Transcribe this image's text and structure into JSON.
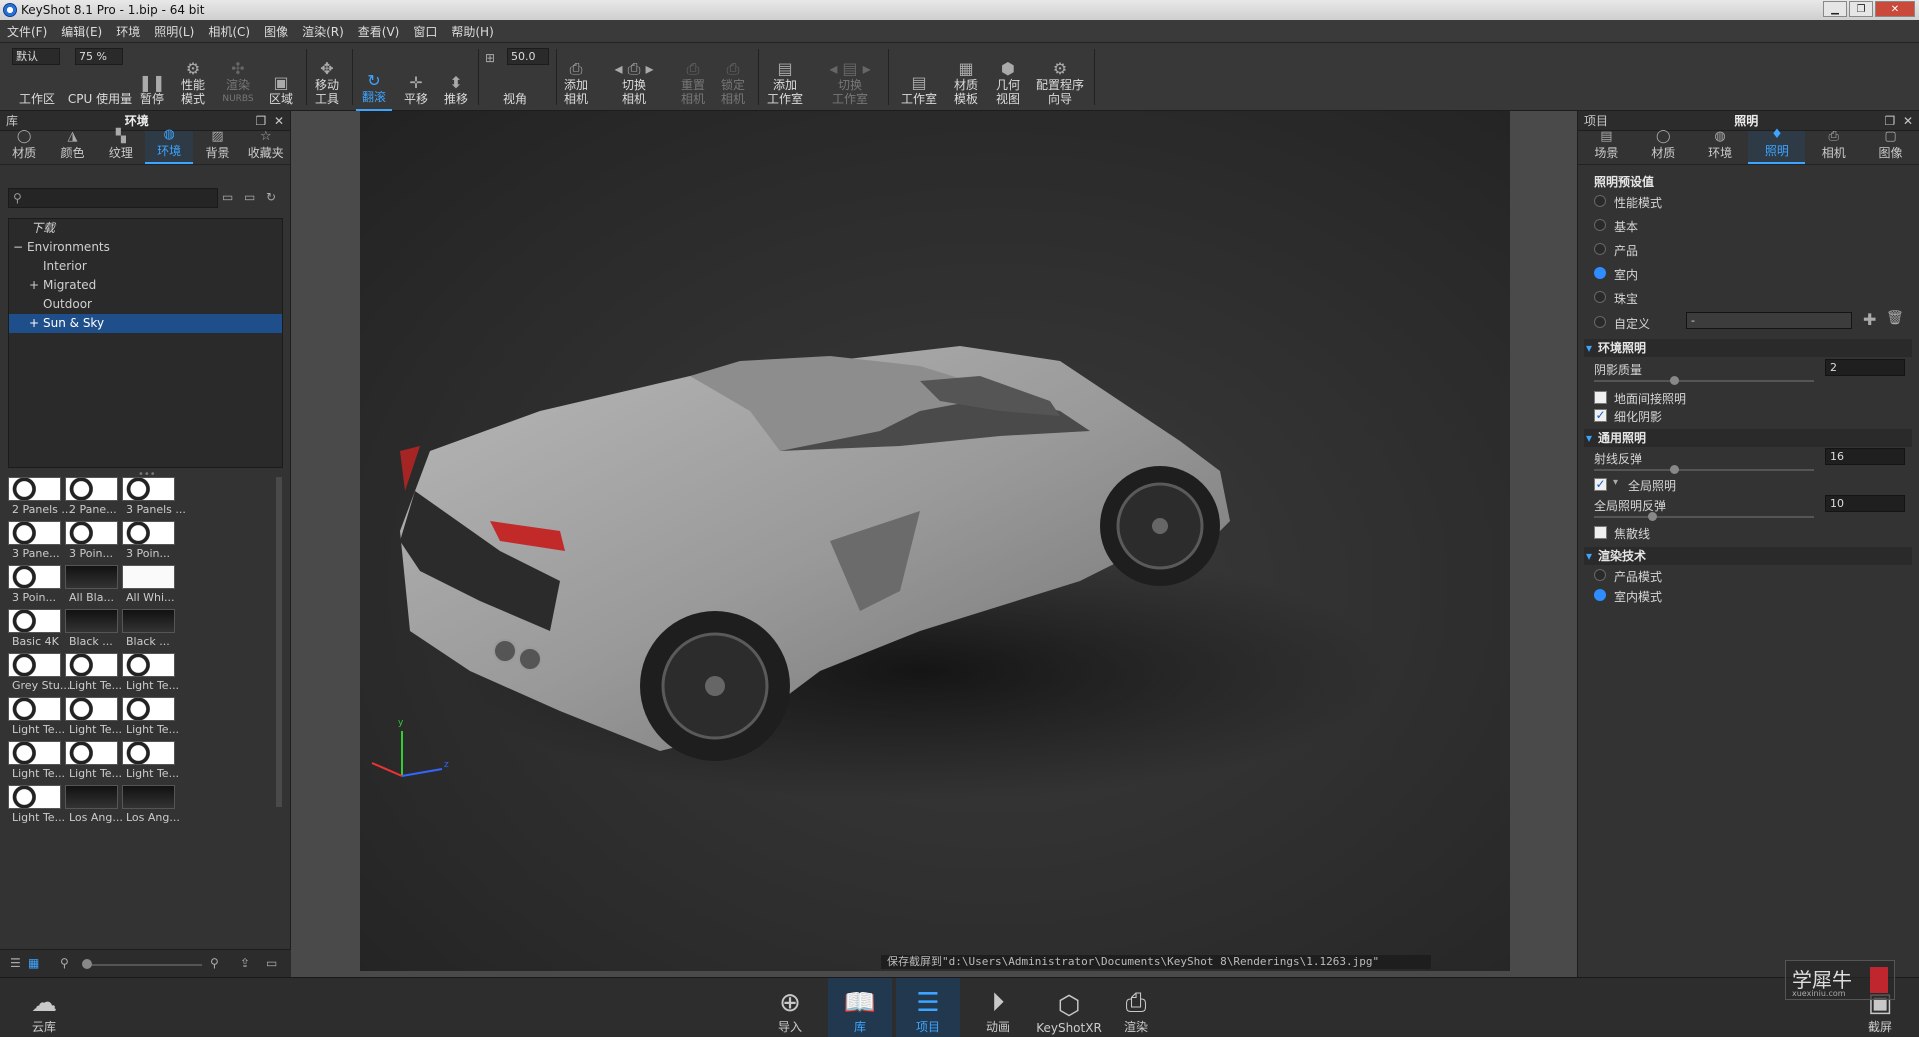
{
  "window": {
    "title": "KeyShot 8.1 Pro  - 1.bip  - 64 bit"
  },
  "menu": [
    "文件(F)",
    "编辑(E)",
    "环境",
    "照明(L)",
    "相机(C)",
    "图像",
    "渲染(R)",
    "查看(V)",
    "窗口",
    "帮助(H)"
  ],
  "toolbar": {
    "workspace_value": "默认",
    "workspace_label": "工作区",
    "cpu_value": "75 %",
    "cpu_label": "CPU 使用量",
    "pause": "暂停",
    "perf_mode_1": "性能",
    "perf_mode_2": "模式",
    "nurbs_1": "渲染",
    "nurbs_2": "NURBS",
    "region": "区域",
    "move_1": "移动",
    "move_2": "工具",
    "tumble": "翻滚",
    "pan": "平移",
    "dolly": "推移",
    "fov_value": "50.0",
    "fov_label": "视角",
    "add_cam_1": "添加",
    "add_cam_2": "相机",
    "switch_cam_1": "切换",
    "switch_cam_2": "相机",
    "reset_cam_1": "重置",
    "reset_cam_2": "相机",
    "lock_cam_1": "锁定",
    "lock_cam_2": "相机",
    "add_studio_1": "添加",
    "add_studio_2": "工作室",
    "switch_studio_1": "切换",
    "switch_studio_2": "工作室",
    "studio": "工作室",
    "mat_tpl_1": "材质",
    "mat_tpl_2": "模板",
    "geo_view_1": "几何",
    "geo_view_2": "视图",
    "wizard_1": "配置程序",
    "wizard_2": "向导"
  },
  "library": {
    "header": "库",
    "title": "环境",
    "tabs": [
      "材质",
      "颜色",
      "纹理",
      "环境",
      "背景",
      "收藏夹"
    ],
    "tree": [
      {
        "label": "下载",
        "indent": 0,
        "expander": ""
      },
      {
        "label": "Environments",
        "indent": 0,
        "expander": "−"
      },
      {
        "label": "Interior",
        "indent": 1,
        "expander": ""
      },
      {
        "label": "Migrated",
        "indent": 1,
        "expander": "+"
      },
      {
        "label": "Outdoor",
        "indent": 1,
        "expander": ""
      },
      {
        "label": "Sun & Sky",
        "indent": 1,
        "expander": "+"
      }
    ],
    "thumbnails": [
      "2 Panels ...",
      "2 Pane...",
      "3 Panels ...",
      "3 Pane...",
      "3 Poin...",
      "3 Poin...",
      "3 Poin...",
      "All Bla...",
      "All Whi...",
      "Basic 4K",
      "Black ...",
      "Black ...",
      "Grey Stu...",
      "Light Te...",
      "Light Te...",
      "Light Te...",
      "Light Te...",
      "Light Te...",
      "Light Te...",
      "Light Te...",
      "Light Te...",
      "Light Te...",
      "Los Ang...",
      "Los Ang..."
    ]
  },
  "viewport": {
    "status": "保存截屏到\"d:\\Users\\Administrator\\Documents\\KeyShot 8\\Renderings\\1.1263.jpg\""
  },
  "project": {
    "header": "项目",
    "title": "照明",
    "tabs": [
      "场景",
      "材质",
      "环境",
      "照明",
      "相机",
      "图像"
    ],
    "presets_title": "照明预设值",
    "presets": [
      "性能模式",
      "基本",
      "产品",
      "室内",
      "珠宝",
      "自定义"
    ],
    "custom_value": "-",
    "env_lighting": "环境照明",
    "shadow_quality_label": "阴影质量",
    "shadow_quality_value": "2",
    "ground_indirect": "地面间接照明",
    "refine_shadows": "细化阴影",
    "general_lighting": "通用照明",
    "ray_bounces_label": "射线反弹",
    "ray_bounces_value": "16",
    "gi_label": "全局照明",
    "gi_bounces_label": "全局照明反弹",
    "gi_bounces_value": "10",
    "caustics": "焦散线",
    "render_tech": "渲染技术",
    "tech_options": [
      "产品模式",
      "室内模式"
    ]
  },
  "bottom": {
    "cloud": "云库",
    "import": "导入",
    "library": "库",
    "project": "项目",
    "animation": "动画",
    "keyshotxr": "KeyShotXR",
    "render": "渲染",
    "screenshot": "截屏"
  },
  "watermark": "学犀牛",
  "watermark_sub": "xuexiniu.com"
}
